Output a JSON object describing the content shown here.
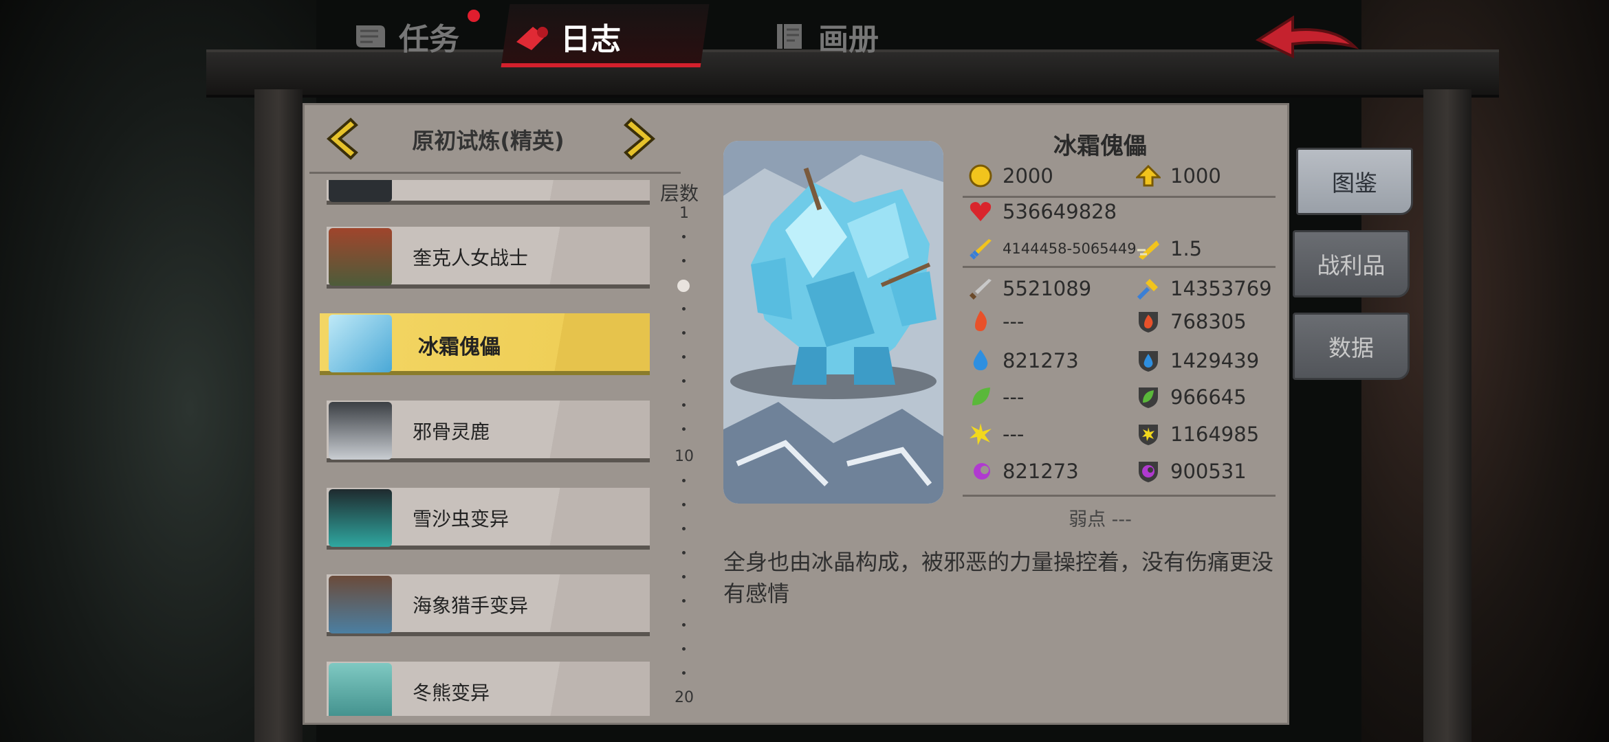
{
  "tabs": [
    {
      "label": "任务",
      "icon": "scroll-icon",
      "badge": true
    },
    {
      "label": "日志",
      "icon": "horn-icon",
      "active": true
    },
    {
      "label": "画册",
      "icon": "book-icon"
    }
  ],
  "stage": {
    "title": "原初试炼(精英)"
  },
  "list": {
    "entries": [
      {
        "name": "",
        "portrait": "creature-portrait"
      },
      {
        "name": "奎克人女战士",
        "portrait": "troll-warrior-portrait"
      },
      {
        "name": "冰霜傀儡",
        "portrait": "ice-golem-portrait",
        "active": true
      },
      {
        "name": "邪骨灵鹿",
        "portrait": "bone-deer-portrait"
      },
      {
        "name": "雪沙虫变异",
        "portrait": "sandworm-portrait"
      },
      {
        "name": "海象猎手变异",
        "portrait": "walrus-hunter-portrait"
      },
      {
        "name": "冬熊变异",
        "portrait": "bear-portrait"
      }
    ]
  },
  "scale": {
    "title": "层数",
    "marks": [
      "1",
      "10",
      "20"
    ],
    "current_level": 4
  },
  "monster": {
    "name": "冰霜傀儡",
    "gold": "2000",
    "exp": "1000",
    "hp": "536649828",
    "attack": "4144458-5065449",
    "attack_speed": "1.5",
    "physical_pierce": "5521089",
    "physical_defense": "14353769",
    "fire_attack": "---",
    "fire_resist": "768305",
    "water_attack": "821273",
    "water_resist": "1429439",
    "nature_attack": "---",
    "nature_resist": "966645",
    "light_attack": "---",
    "light_resist": "1164985",
    "dark_attack": "821273",
    "dark_resist": "900531",
    "weakness": "弱点 ---",
    "description": "全身也由冰晶构成，被邪恶的力量操控着，没有伤痛更没有感情"
  },
  "side_buttons": [
    {
      "label": "图鉴",
      "active": true
    },
    {
      "label": "战利品"
    },
    {
      "label": "数据"
    }
  ],
  "colors": {
    "accent_red": "#d4202c",
    "highlight_yellow": "#f3d664",
    "panel": "#9c958f"
  }
}
